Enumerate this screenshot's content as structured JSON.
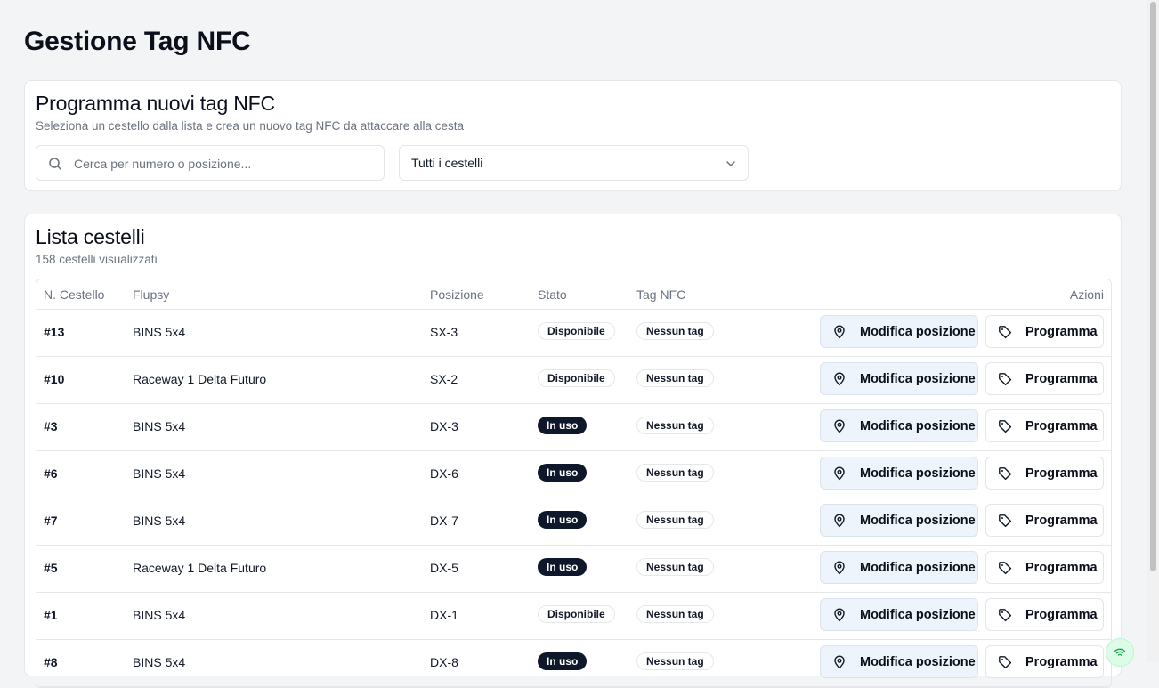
{
  "page": {
    "title": "Gestione Tag NFC"
  },
  "program_card": {
    "title": "Programma nuovi tag NFC",
    "subtitle": "Seleziona un cestello dalla lista e crea un nuovo tag NFC da attaccare alla cesta",
    "search_placeholder": "Cerca per numero o posizione...",
    "filter_value": "Tutti i cestelli"
  },
  "list_card": {
    "title": "Lista cestelli",
    "subtitle": "158 cestelli visualizzati",
    "columns": [
      "N. Cestello",
      "Flupsy",
      "Posizione",
      "Stato",
      "Tag NFC",
      "Azioni"
    ],
    "action_labels": {
      "modify": "Modifica posizione",
      "program": "Programma"
    },
    "rows": [
      {
        "num": "#13",
        "flupsy": "BINS 5x4",
        "pos": "SX-3",
        "stato": "Disponibile",
        "tag": "Nessun tag"
      },
      {
        "num": "#10",
        "flupsy": "Raceway 1 Delta Futuro",
        "pos": "SX-2",
        "stato": "Disponibile",
        "tag": "Nessun tag"
      },
      {
        "num": "#3",
        "flupsy": "BINS 5x4",
        "pos": "DX-3",
        "stato": "In uso",
        "tag": "Nessun tag"
      },
      {
        "num": "#6",
        "flupsy": "BINS 5x4",
        "pos": "DX-6",
        "stato": "In uso",
        "tag": "Nessun tag"
      },
      {
        "num": "#7",
        "flupsy": "BINS 5x4",
        "pos": "DX-7",
        "stato": "In uso",
        "tag": "Nessun tag"
      },
      {
        "num": "#5",
        "flupsy": "Raceway 1 Delta Futuro",
        "pos": "DX-5",
        "stato": "In uso",
        "tag": "Nessun tag"
      },
      {
        "num": "#1",
        "flupsy": "BINS 5x4",
        "pos": "DX-1",
        "stato": "Disponibile",
        "tag": "Nessun tag"
      },
      {
        "num": "#8",
        "flupsy": "BINS 5x4",
        "pos": "DX-8",
        "stato": "In uso",
        "tag": "Nessun tag"
      }
    ]
  },
  "colors": {
    "solid_badge": "#0f172a",
    "modify_button_bg": "#eef4fc",
    "nfc_fab_bg": "#dcfce7"
  },
  "icons": {
    "search": "search-icon",
    "chevron": "chevron-down-icon",
    "pin": "map-pin-icon",
    "tag": "tag-icon",
    "nfc": "nfc-signal-icon"
  }
}
